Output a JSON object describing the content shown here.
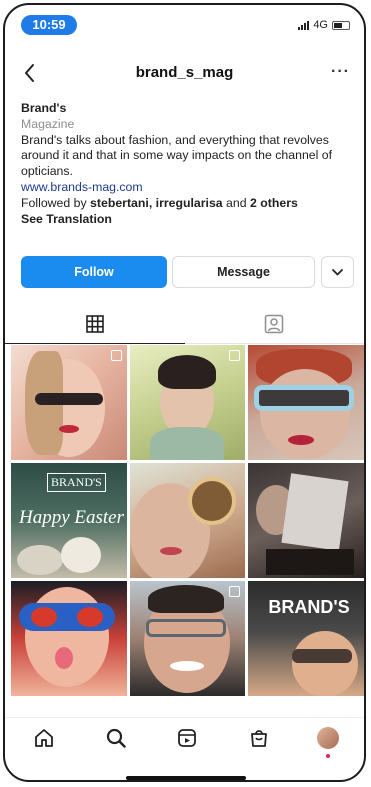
{
  "status_bar": {
    "time": "10:59",
    "network": "4G"
  },
  "header": {
    "username": "brand_s_mag",
    "more_label": "···"
  },
  "bio": {
    "name": "Brand's",
    "category": "Magazine",
    "description": "Brand's talks about fashion, and everything that revolves around it and that in some way impacts on the channel of opticians.",
    "link": "www.brands-mag.com",
    "followed_prefix": "Followed by ",
    "followed_users": "stebertani, irregularisa",
    "followed_and": " and ",
    "followed_others": "2 others",
    "see_translation": "See Translation"
  },
  "actions": {
    "follow_label": "Follow",
    "message_label": "Message"
  },
  "grid": {
    "posts": [
      {
        "subject": "woman-with-round-sunglasses"
      },
      {
        "subject": "woman-with-glasses-strap"
      },
      {
        "subject": "woman-with-blue-sunglasses"
      },
      {
        "subject": "happy-easter-post",
        "text": "Happy Easter",
        "badge": "BRAND'S"
      },
      {
        "subject": "woman-with-decorated-lens"
      },
      {
        "subject": "man-reading-magazine"
      },
      {
        "subject": "woman-with-red-blue-glasses"
      },
      {
        "subject": "man-with-grey-glasses"
      },
      {
        "subject": "brands-magazine-cover",
        "badge": "BRAND'S"
      }
    ]
  },
  "colors": {
    "accent": "#1a8cf0",
    "time_pill": "#1f7be8",
    "link": "#1e3a8a",
    "muted": "#8e8e8e"
  },
  "icons": [
    "back-arrow-icon",
    "more-icon",
    "chevron-down-icon",
    "grid-icon",
    "tagged-icon",
    "home-icon",
    "search-icon",
    "reels-icon",
    "shop-icon",
    "profile-avatar"
  ]
}
